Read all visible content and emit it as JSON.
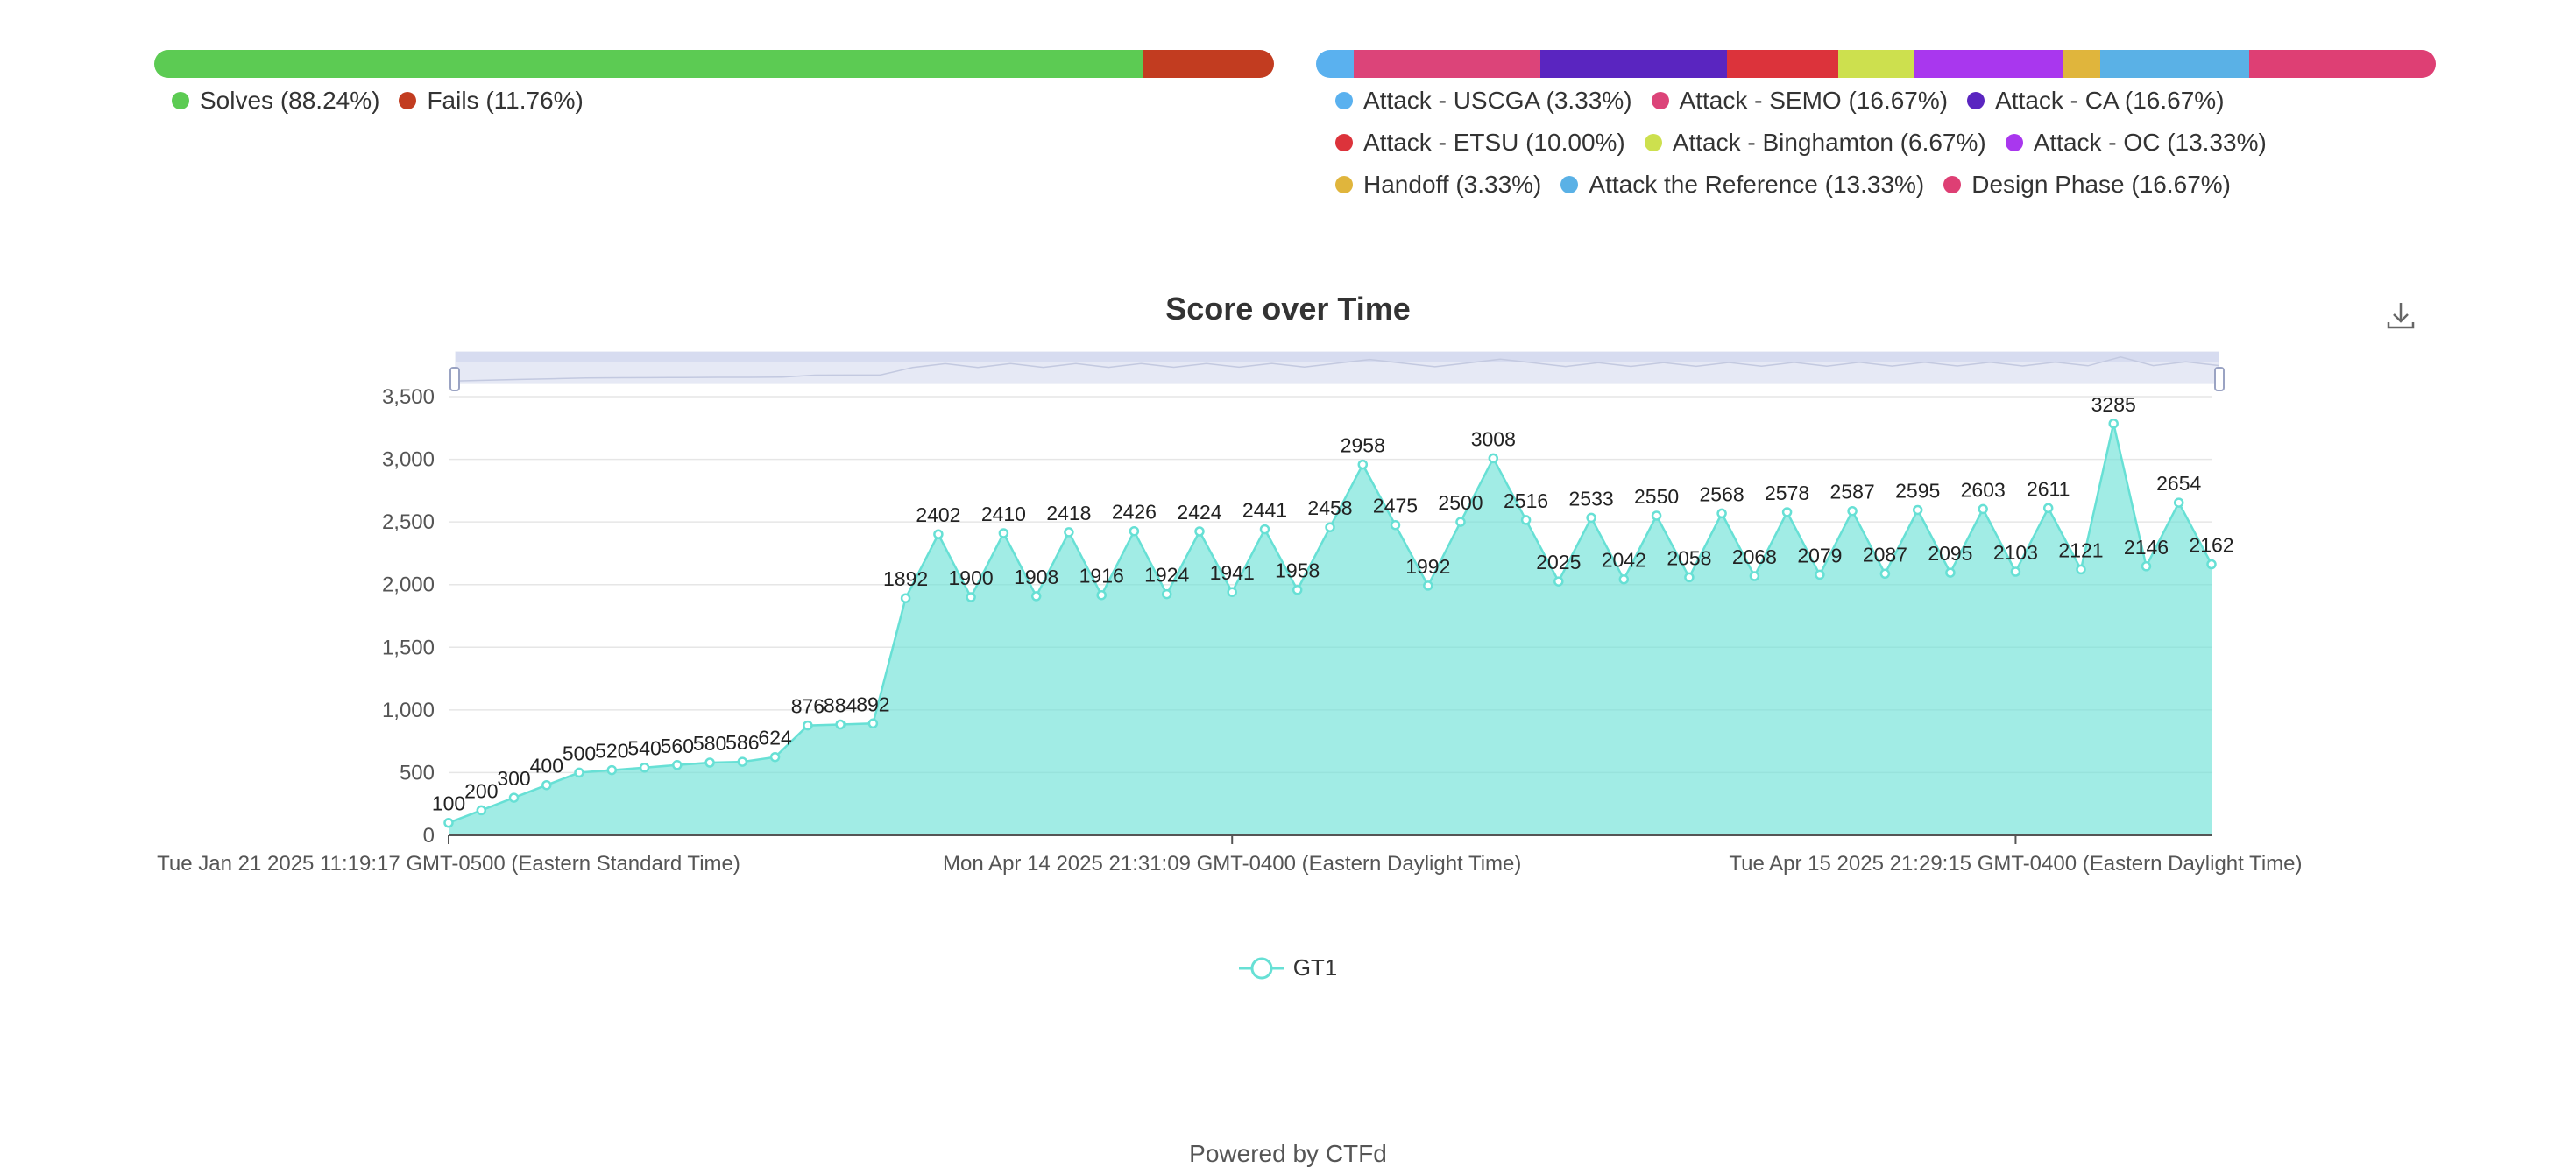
{
  "solves_bar": {
    "segments": [
      {
        "label": "Solves (88.24%)",
        "value": 88.24,
        "color": "#5ccb53"
      },
      {
        "label": "Fails (11.76%)",
        "value": 11.76,
        "color": "#c23c20"
      }
    ]
  },
  "category_bar": {
    "segments": [
      {
        "label": "Attack - USCGA (3.33%)",
        "value": 3.33,
        "color": "#5ab1ef"
      },
      {
        "label": "Attack - SEMO (16.67%)",
        "value": 16.67,
        "color": "#dc4479"
      },
      {
        "label": "Attack - CA (16.67%)",
        "value": 16.67,
        "color": "#5a25c0"
      },
      {
        "label": "Attack - ETSU (10.00%)",
        "value": 10.0,
        "color": "#dc333b"
      },
      {
        "label": "Attack - Binghamton (6.67%)",
        "value": 6.67,
        "color": "#cde04e"
      },
      {
        "label": "Attack - OC (13.33%)",
        "value": 13.33,
        "color": "#a937ee"
      },
      {
        "label": "Handoff (3.33%)",
        "value": 3.33,
        "color": "#e0b53c"
      },
      {
        "label": "Attack the Reference (13.33%)",
        "value": 13.33,
        "color": "#5ab1e6"
      },
      {
        "label": "Design Phase (16.67%)",
        "value": 16.67,
        "color": "#de3f74"
      }
    ]
  },
  "chart": {
    "title": "Score over Time",
    "download_icon": "download-icon"
  },
  "chart_data": {
    "type": "area",
    "title": "Score over Time",
    "ylim": [
      0,
      3500
    ],
    "y_ticks": [
      "0",
      "500",
      "1,000",
      "1,500",
      "2,000",
      "2,500",
      "3,000",
      "3,500"
    ],
    "x_tick_labels": [
      "Tue Jan 21 2025 11:19:17 GMT-0500 (Eastern Standard Time)",
      "Mon Apr 14 2025 21:31:09 GMT-0400 (Eastern Daylight Time)",
      "Tue Apr 15 2025 21:29:15 GMT-0400 (Eastern Daylight Time)"
    ],
    "grid": true,
    "color": "#67e0d5",
    "series": [
      {
        "name": "GT1",
        "values": [
          100,
          200,
          300,
          400,
          500,
          520,
          540,
          560,
          580,
          586,
          624,
          876,
          884,
          892,
          1892,
          2402,
          1900,
          2410,
          1908,
          2418,
          1916,
          2426,
          1924,
          2424,
          1941,
          2441,
          1958,
          2458,
          2958,
          2475,
          1992,
          2500,
          3008,
          2516,
          2025,
          2533,
          2042,
          2550,
          2058,
          2568,
          2068,
          2578,
          2079,
          2587,
          2087,
          2595,
          2095,
          2603,
          2103,
          2611,
          2121,
          3285,
          2146,
          2654,
          2162
        ]
      }
    ],
    "data_labels": [
      "100",
      "200",
      "300",
      "400",
      "500",
      "520",
      "540",
      "560",
      "580",
      "586",
      "624",
      "876",
      "884",
      "892",
      "1892",
      "2402",
      "1900",
      "2410",
      "1908",
      "2418",
      "1916",
      "2426",
      "1924",
      "2424",
      "1941",
      "2441",
      "1958",
      "2458",
      "2958",
      "2475",
      "1992",
      "2500",
      "3008",
      "2516",
      "2025",
      "2533",
      "2042",
      "2550",
      "2058",
      "2568",
      "2068",
      "2578",
      "2079",
      "2587",
      "2087",
      "2595",
      "2095",
      "2603",
      "2103",
      "2611",
      "2121",
      "3285",
      "2146",
      "2654",
      "2162"
    ],
    "legend_position": "bottom"
  },
  "footer": {
    "text": "Powered by CTFd"
  }
}
